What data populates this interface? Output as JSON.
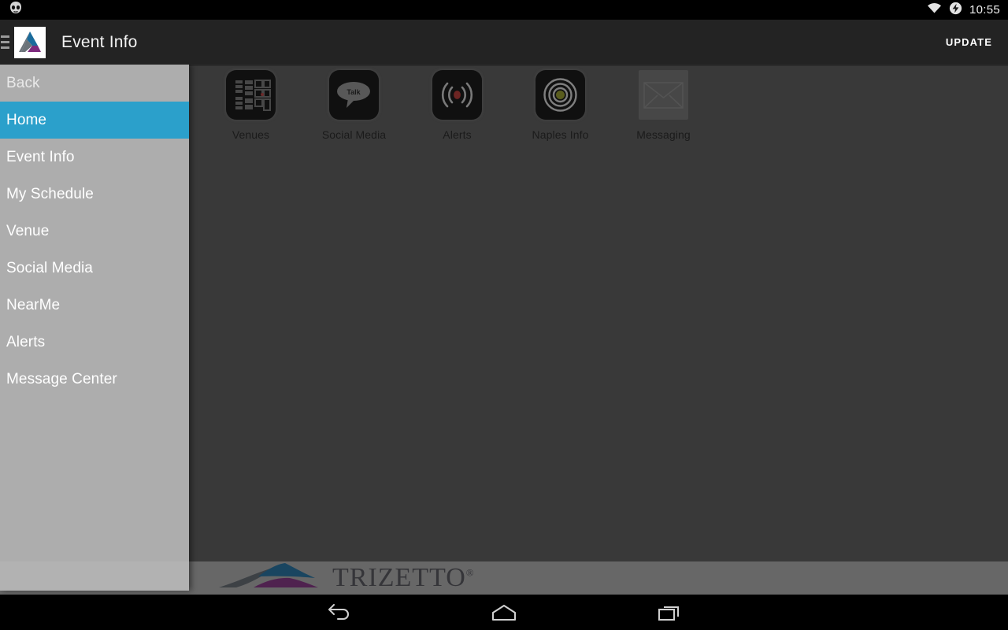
{
  "status_bar": {
    "os_logo_icon": "cyanogenmod-icon",
    "wifi_icon": "wifi-icon",
    "battery_icon": "battery-charging-icon",
    "clock": "10:55"
  },
  "action_bar": {
    "drawer_indicator_icon": "hamburger-menu-icon",
    "app_logo_icon": "trizetto-logo-icon",
    "title": "Event Info",
    "update_label": "UPDATE"
  },
  "drawer": {
    "items": [
      {
        "label": "Back",
        "selected": false
      },
      {
        "label": "Home",
        "selected": true
      },
      {
        "label": "Event Info",
        "selected": false
      },
      {
        "label": "My Schedule",
        "selected": false
      },
      {
        "label": "Venue",
        "selected": false
      },
      {
        "label": "Social Media",
        "selected": false
      },
      {
        "label": "NearMe",
        "selected": false
      },
      {
        "label": "Alerts",
        "selected": false
      },
      {
        "label": "Message Center",
        "selected": false
      }
    ],
    "selected_color": "#2ba0cb"
  },
  "home_grid": {
    "tiles": [
      {
        "label": "Venues",
        "icon": "venue-floorplan-icon"
      },
      {
        "label": "Social Media",
        "icon": "talk-bubble-icon"
      },
      {
        "label": "Alerts",
        "icon": "broadcast-alert-icon"
      },
      {
        "label": "Naples Info",
        "icon": "concentric-target-icon"
      },
      {
        "label": "Messaging",
        "icon": "envelope-icon"
      }
    ]
  },
  "footer": {
    "brand_text": "TRIZETTO",
    "brand_mark_icon": "trizetto-mountain-icon",
    "trademark": "®"
  },
  "nav_bar": {
    "back_icon": "back-arrow-icon",
    "home_icon": "home-icon",
    "recents_icon": "recent-apps-icon"
  },
  "colors": {
    "accent": "#2ba0cb",
    "action_bar": "#232323",
    "content_bg": "#545454",
    "drawer_bg": "#bababa",
    "logo_blue": "#1a6b9c",
    "logo_purple": "#7d2a7d",
    "logo_grey": "#6b737a"
  }
}
